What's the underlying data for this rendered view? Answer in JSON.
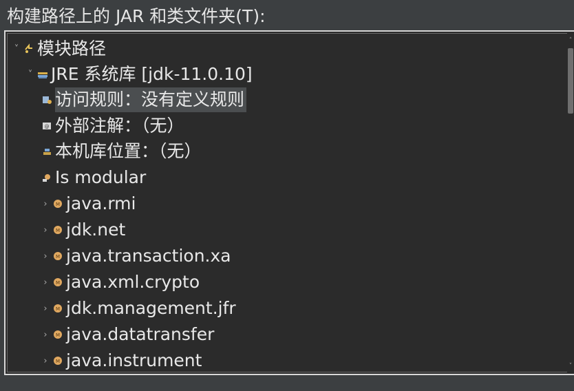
{
  "header": {
    "label": "构建路径上的 JAR 和类文件夹(T):"
  },
  "tree": {
    "items": [
      {
        "label": "模块路径",
        "twisty": "˅",
        "icon": "module-path-icon"
      },
      {
        "label": "JRE 系统库 [jdk-11.0.10]",
        "twisty": "˅",
        "icon": "library-icon"
      },
      {
        "label": "访问规则：没有定义规则",
        "twisty": "",
        "icon": "access-rules-icon"
      },
      {
        "label": "外部注解：（无）",
        "twisty": "",
        "icon": "annotations-icon"
      },
      {
        "label": "本机库位置：（无）",
        "twisty": "",
        "icon": "native-library-icon"
      },
      {
        "label": "Is modular",
        "twisty": "",
        "icon": "modular-icon"
      },
      {
        "label": "java.rmi",
        "twisty": "›",
        "icon": "module-icon"
      },
      {
        "label": "jdk.net",
        "twisty": "›",
        "icon": "module-icon"
      },
      {
        "label": "java.transaction.xa",
        "twisty": "›",
        "icon": "module-icon"
      },
      {
        "label": "java.xml.crypto",
        "twisty": "›",
        "icon": "module-icon"
      },
      {
        "label": "jdk.management.jfr",
        "twisty": "›",
        "icon": "module-icon"
      },
      {
        "label": "java.datatransfer",
        "twisty": "›",
        "icon": "module-icon"
      },
      {
        "label": "java.instrument",
        "twisty": "›",
        "icon": "module-icon"
      }
    ]
  },
  "scrollbar": {
    "up_glyph": "˄",
    "down_glyph": "˅"
  },
  "colors": {
    "background": "#2b2b2b",
    "text": "#e8e8e8",
    "selection": "#4b4e50",
    "module_badge": "#e0a860"
  }
}
